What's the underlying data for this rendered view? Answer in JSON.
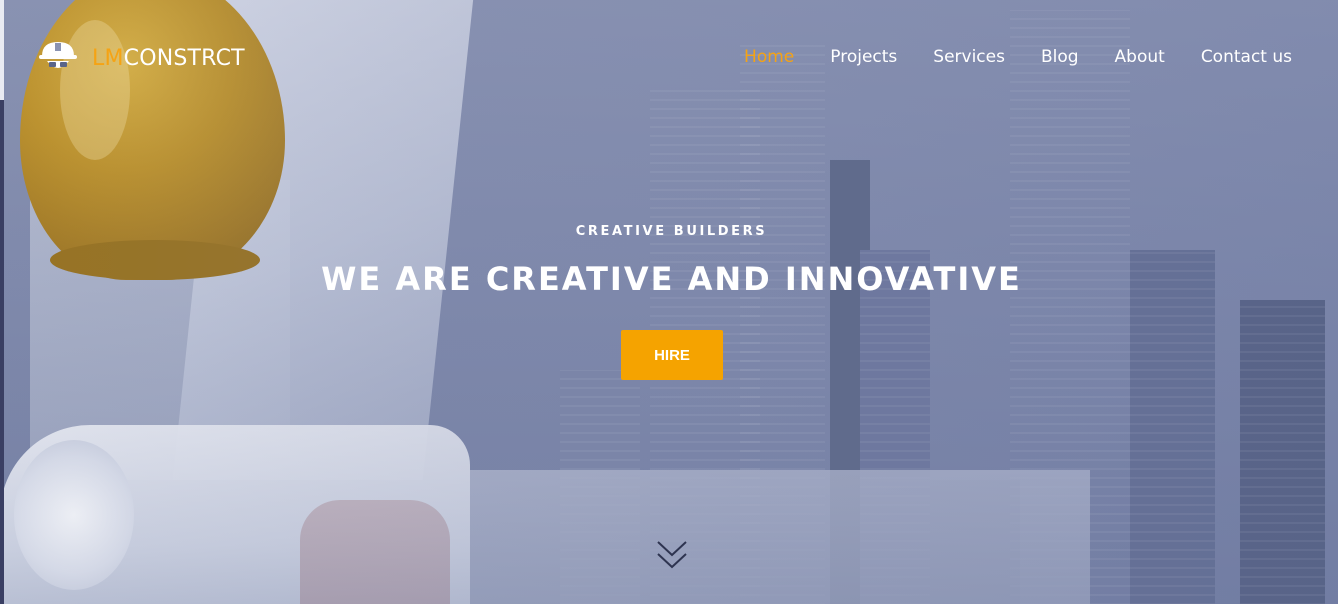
{
  "brand": {
    "name_part1": "LM",
    "name_part2": "CONSTRCT",
    "logo_icon": "construction-worker-icon",
    "accent_color": "#f5a314"
  },
  "nav": {
    "items": [
      {
        "label": "Home",
        "active": true
      },
      {
        "label": "Projects",
        "active": false
      },
      {
        "label": "Services",
        "active": false
      },
      {
        "label": "Blog",
        "active": false
      },
      {
        "label": "About",
        "active": false
      },
      {
        "label": "Contact us",
        "active": false
      }
    ]
  },
  "hero": {
    "subtitle": "CREATIVE BUILDERS",
    "title": "WE ARE CREATIVE AND INNOVATIVE",
    "cta_label": "HIRE",
    "cta_color": "#f5a300",
    "scroll_icon": "double-chevron-down-icon"
  }
}
